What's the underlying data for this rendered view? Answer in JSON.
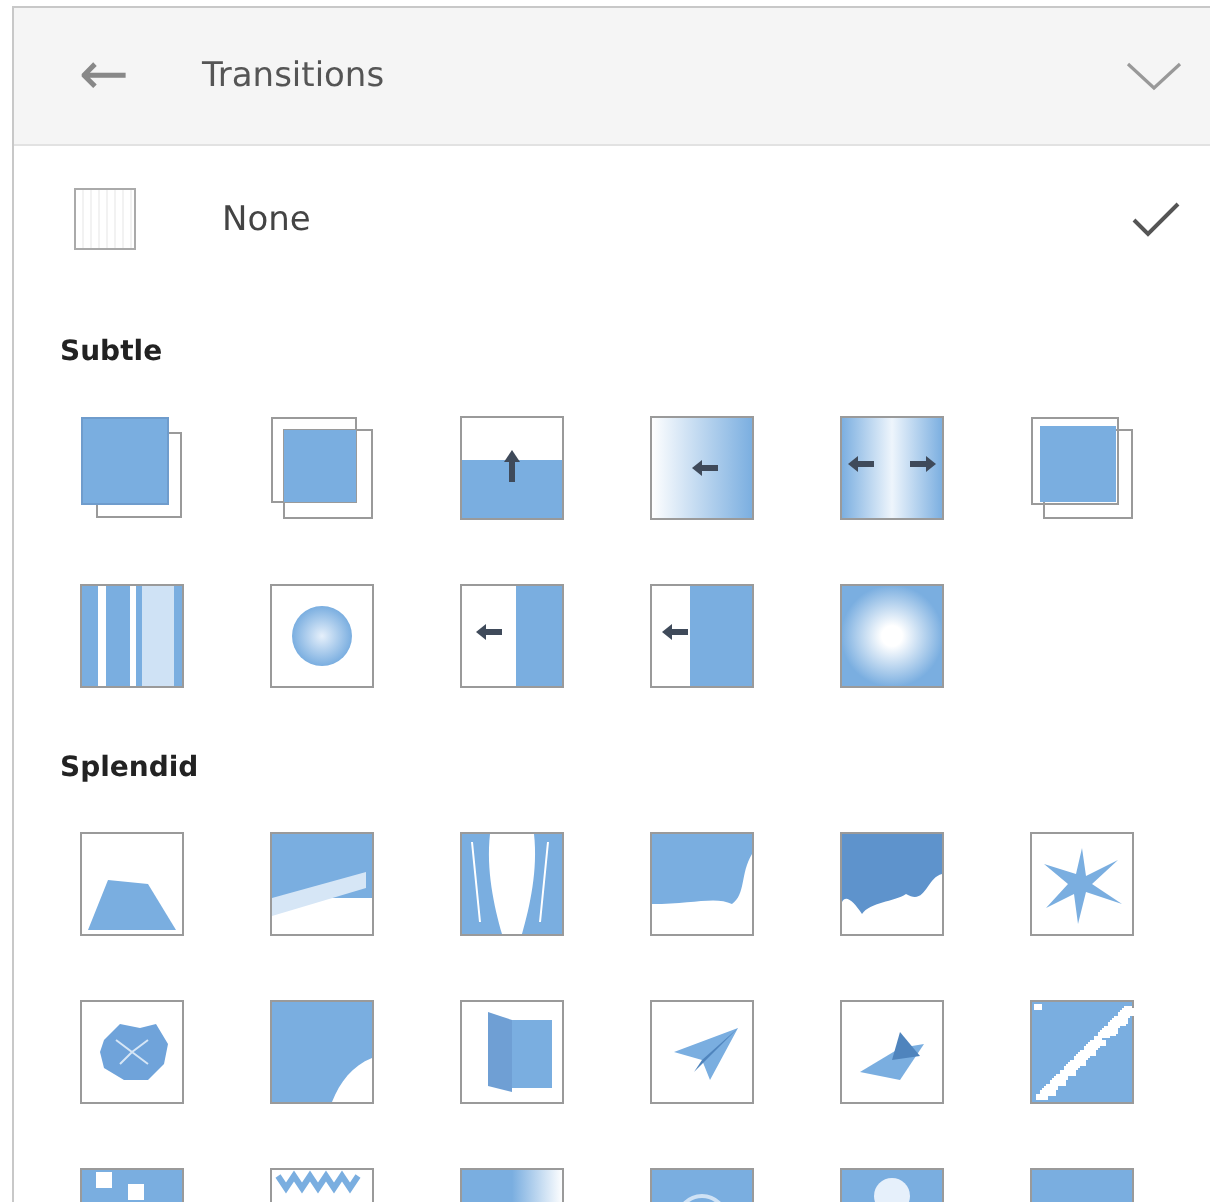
{
  "header": {
    "back_icon": "←",
    "title": "Transitions"
  },
  "none_option": {
    "label": "None",
    "selected": true
  },
  "sections": [
    {
      "title": "Subtle",
      "transitions": [
        {
          "kind": "fade"
        },
        {
          "kind": "cut"
        },
        {
          "kind": "push"
        },
        {
          "kind": "wipe"
        },
        {
          "kind": "split"
        },
        {
          "kind": "reveal"
        },
        {
          "kind": "random_bars"
        },
        {
          "kind": "shape"
        },
        {
          "kind": "uncover"
        },
        {
          "kind": "cover"
        },
        {
          "kind": "flash"
        }
      ]
    },
    {
      "title": "Splendid",
      "transitions": [
        {
          "kind": "fall_over"
        },
        {
          "kind": "drape"
        },
        {
          "kind": "curtains"
        },
        {
          "kind": "wind"
        },
        {
          "kind": "prestige"
        },
        {
          "kind": "fracture"
        },
        {
          "kind": "crush"
        },
        {
          "kind": "peel_off"
        },
        {
          "kind": "page_curl"
        },
        {
          "kind": "airplane"
        },
        {
          "kind": "origami"
        },
        {
          "kind": "dissolve"
        },
        {
          "kind": "checkerboard"
        },
        {
          "kind": "blinds"
        },
        {
          "kind": "clock"
        },
        {
          "kind": "ripple"
        },
        {
          "kind": "honeycomb"
        },
        {
          "kind": "glitter"
        }
      ]
    }
  ]
}
